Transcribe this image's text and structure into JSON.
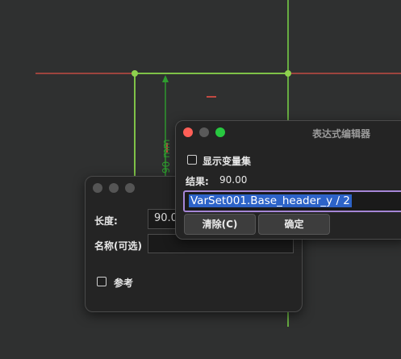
{
  "viewport": {
    "dimension_label": "90 mm",
    "dimension_label_partial": "90 mm"
  },
  "length_dialog": {
    "title": "",
    "length_label": "长度:",
    "length_value": "90.0",
    "name_label": "名称(可选)",
    "name_value": "",
    "reference_label": "参考",
    "reference_checked": false
  },
  "expression_dialog": {
    "title": "表达式编辑器",
    "show_varset_label": "显示变量集",
    "show_varset_checked": false,
    "result_label": "结果:",
    "result_value": "90.00",
    "expression": "VarSet001.Base_header_y / 2",
    "clear_button": "清除(C)",
    "ok_button": "确定"
  },
  "colors": {
    "background": "#2f3030",
    "axis_red": "#c24a42",
    "constraint_green": "#7fc248",
    "dimension_green": "#2f9e2f",
    "selection_blue": "#2d63c8",
    "focus_purple": "#a586d6"
  }
}
